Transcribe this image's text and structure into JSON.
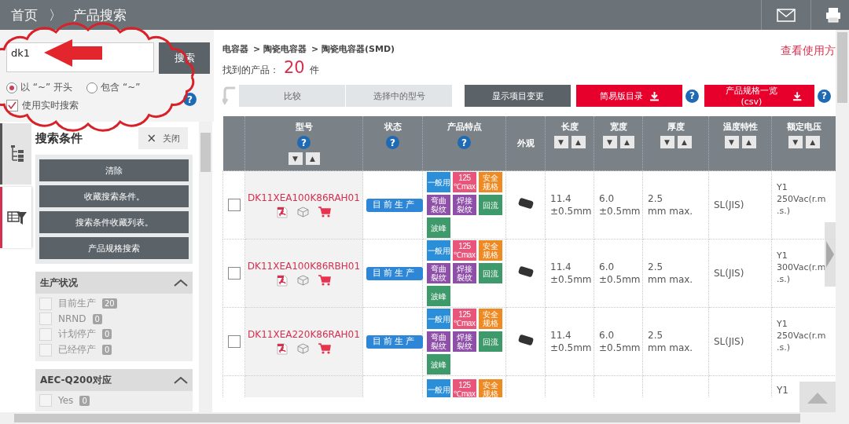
{
  "header": {
    "home": "首页",
    "separator": "〉",
    "title": "产品搜索"
  },
  "search": {
    "value": "dk1",
    "button": "搜索",
    "match_modes": [
      {
        "label": "以 “~” 开头",
        "selected": true
      },
      {
        "label": "包含 “~”",
        "selected": false
      }
    ],
    "realtime": {
      "label": "使用实时搜索",
      "checked": true
    },
    "help": "?"
  },
  "sidebar": {
    "tabs": [
      {
        "kind": "tree",
        "selected": false
      },
      {
        "kind": "filter",
        "selected": true
      }
    ],
    "title": "搜索条件",
    "close": {
      "icon": "×",
      "label": "关闭"
    },
    "actions": [
      "清除",
      "收藏搜索条件。",
      "搜索条件收藏列表。",
      "产品规格搜索"
    ],
    "filters": [
      {
        "title": "生产状况",
        "expanded": true,
        "options": [
          {
            "label": "目前生产",
            "count": "20",
            "checked": false,
            "disabled": true
          },
          {
            "label": "NRND",
            "count": "0",
            "checked": false,
            "disabled": true
          },
          {
            "label": "计划停产",
            "count": "0",
            "checked": false,
            "disabled": true
          },
          {
            "label": "已经停产",
            "count": "0",
            "checked": false,
            "disabled": true
          }
        ]
      },
      {
        "title": "AEC-Q200对应",
        "expanded": true,
        "options": [
          {
            "label": "Yes",
            "count": "0",
            "checked": false,
            "disabled": true
          }
        ]
      }
    ]
  },
  "results": {
    "breadcrumb": [
      "电容器",
      "> 陶瓷电容器",
      "> 陶瓷电容器(SMD)"
    ],
    "usage_link": "查看使用方",
    "found_label": "找到的产品：",
    "found_count": "20",
    "found_unit": "件",
    "toolbar": {
      "compare": "比较",
      "selected_models": "选择中的型号",
      "display_settings": "显示项目变更",
      "downloads": [
        {
          "label": "简易版目录",
          "help": "?"
        },
        {
          "label": "产品规格一览(csv)",
          "help": "?"
        }
      ]
    }
  },
  "table": {
    "columns": [
      {
        "label": "型号",
        "help": "?",
        "sort": [
          "▼",
          "▲"
        ]
      },
      {
        "label": "状态",
        "help": "?"
      },
      {
        "label": "产品特点",
        "help": "?"
      },
      {
        "label": "外观"
      },
      {
        "label": "长度",
        "sort": [
          "▼",
          "▲"
        ]
      },
      {
        "label": "宽度",
        "sort": [
          "▼",
          "▲"
        ]
      },
      {
        "label": "厚度",
        "sort": [
          "▼",
          "▲"
        ]
      },
      {
        "label": "温度特性",
        "sort": [
          "▼",
          "▲"
        ]
      },
      {
        "label": "额定电压",
        "sort": [
          "▼",
          "▲"
        ]
      }
    ],
    "rows": [
      {
        "selected": false,
        "part_number": "DK11XEA100K86RAH01",
        "status": "目前生产",
        "features": [
          {
            "kind": "label",
            "text": "一般用",
            "color": "#2a8fd8"
          },
          {
            "kind": "rating",
            "text": "125\n℃max",
            "color": "#e8547a"
          },
          {
            "kind": "stacked",
            "text": "安全规格",
            "color": "#ef8a22"
          },
          {
            "kind": "stacked",
            "text": "弯曲裂纹",
            "color": "#8d4fa8"
          },
          {
            "kind": "stacked",
            "text": "焊接裂纹",
            "color": "#8d4fa8"
          },
          {
            "kind": "stacked",
            "text": "回流",
            "color": "#3f9a6b"
          },
          {
            "kind": "stacked",
            "text": "波峰",
            "color": "#3f9a6b"
          }
        ],
        "length": "11.4\n±0.5mm",
        "width": "6.0\n±0.5mm",
        "thickness": "2.5\nmm max.",
        "temperature": "SL(JIS)",
        "voltage": "Y1\n250Vac(r.m\n.s.)"
      },
      {
        "selected": false,
        "part_number": "DK11XEA100K86RBH01",
        "status": "目前生产",
        "features": [
          {
            "kind": "label",
            "text": "一般用",
            "color": "#2a8fd8"
          },
          {
            "kind": "rating",
            "text": "125\n℃max",
            "color": "#e8547a"
          },
          {
            "kind": "stacked",
            "text": "安全规格",
            "color": "#ef8a22"
          },
          {
            "kind": "stacked",
            "text": "弯曲裂纹",
            "color": "#8d4fa8"
          },
          {
            "kind": "stacked",
            "text": "焊接裂纹",
            "color": "#8d4fa8"
          },
          {
            "kind": "stacked",
            "text": "回流",
            "color": "#3f9a6b"
          },
          {
            "kind": "stacked",
            "text": "波峰",
            "color": "#3f9a6b"
          }
        ],
        "length": "11.4\n±0.5mm",
        "width": "6.0\n±0.5mm",
        "thickness": "2.5\nmm max.",
        "temperature": "SL(JIS)",
        "voltage": "Y1\n300Vac(r.m\n.s.)"
      },
      {
        "selected": false,
        "part_number": "DK11XEA220K86RAH01",
        "status": "目前生产",
        "features": [
          {
            "kind": "label",
            "text": "一般用",
            "color": "#2a8fd8"
          },
          {
            "kind": "rating",
            "text": "125\n℃max",
            "color": "#e8547a"
          },
          {
            "kind": "stacked",
            "text": "安全规格",
            "color": "#ef8a22"
          },
          {
            "kind": "stacked",
            "text": "弯曲裂纹",
            "color": "#8d4fa8"
          },
          {
            "kind": "stacked",
            "text": "焊接裂纹",
            "color": "#8d4fa8"
          },
          {
            "kind": "stacked",
            "text": "回流",
            "color": "#3f9a6b"
          },
          {
            "kind": "stacked",
            "text": "波峰",
            "color": "#3f9a6b"
          }
        ],
        "length": "11.4\n±0.5mm",
        "width": "6.0\n±0.5mm",
        "thickness": "2.5\nmm max.",
        "temperature": "SL(JIS)",
        "voltage": "Y1\n250Vac(r.m\n.s.)"
      }
    ],
    "cut_row": {
      "features": [
        {
          "kind": "label",
          "text": "一般用",
          "color": "#2a8fd8"
        },
        {
          "kind": "rating",
          "text": "125\n℃max",
          "color": "#e8547a"
        },
        {
          "kind": "stacked",
          "text": "安全规格",
          "color": "#ef8a22"
        }
      ],
      "voltage": "Y1"
    }
  }
}
